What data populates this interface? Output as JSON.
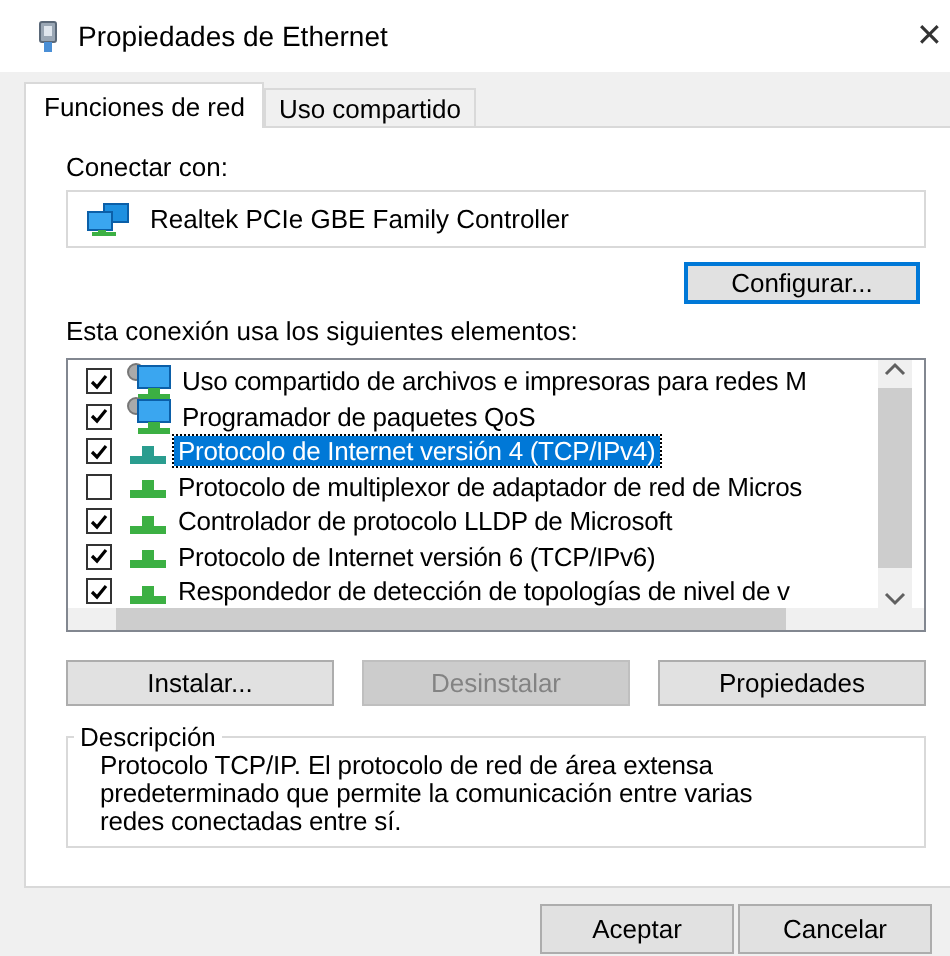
{
  "window": {
    "title": "Propiedades de Ethernet",
    "close": "✕"
  },
  "tabs": [
    {
      "label": "Funciones de red",
      "selected": true
    },
    {
      "label": "Uso compartido",
      "selected": false
    }
  ],
  "connect_label": "Conectar con:",
  "adapter": "Realtek PCIe GBE Family Controller",
  "configure_button": "Configurar...",
  "items_label": "Esta conexión usa los siguientes elementos:",
  "items": [
    {
      "kind": "service",
      "label": "Uso compartido de archivos e impresoras para redes M",
      "checked": true,
      "selected": false
    },
    {
      "kind": "service",
      "label": "Programador de paquetes QoS",
      "checked": true,
      "selected": false
    },
    {
      "kind": "protocol",
      "label": "Protocolo de Internet versión 4 (TCP/IPv4)",
      "checked": true,
      "selected": true
    },
    {
      "kind": "protocol",
      "label": "Protocolo de multiplexor de adaptador de red de Micros",
      "checked": false,
      "selected": false
    },
    {
      "kind": "protocol",
      "label": "Controlador de protocolo LLDP de Microsoft",
      "checked": true,
      "selected": false
    },
    {
      "kind": "protocol",
      "label": "Protocolo de Internet versión 6 (TCP/IPv6)",
      "checked": true,
      "selected": false
    },
    {
      "kind": "protocol",
      "label": "Respondedor de detección de topologías de nivel de v",
      "checked": true,
      "selected": false
    }
  ],
  "item_buttons": [
    {
      "label": "Instalar...",
      "disabled": false
    },
    {
      "label": "Desinstalar",
      "disabled": true
    },
    {
      "label": "Propiedades",
      "disabled": false
    }
  ],
  "description": {
    "legend": "Descripción",
    "text": "Protocolo TCP/IP. El protocolo de red de área extensa predeterminado que permite la comunicación entre varias redes conectadas entre sí."
  },
  "dialog_buttons": [
    {
      "label": "Aceptar",
      "disabled": false
    },
    {
      "label": "Cancelar",
      "disabled": false
    }
  ]
}
